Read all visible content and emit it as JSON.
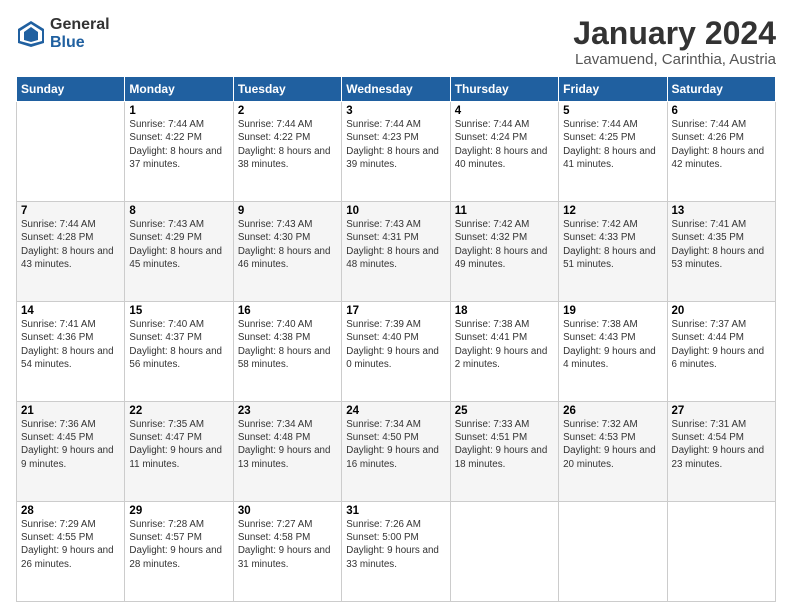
{
  "logo": {
    "general": "General",
    "blue": "Blue"
  },
  "title": "January 2024",
  "subtitle": "Lavamuend, Carinthia, Austria",
  "weekdays": [
    "Sunday",
    "Monday",
    "Tuesday",
    "Wednesday",
    "Thursday",
    "Friday",
    "Saturday"
  ],
  "weeks": [
    [
      {
        "day": "",
        "sunrise": "",
        "sunset": "",
        "daylight": ""
      },
      {
        "day": "1",
        "sunrise": "Sunrise: 7:44 AM",
        "sunset": "Sunset: 4:22 PM",
        "daylight": "Daylight: 8 hours and 37 minutes."
      },
      {
        "day": "2",
        "sunrise": "Sunrise: 7:44 AM",
        "sunset": "Sunset: 4:22 PM",
        "daylight": "Daylight: 8 hours and 38 minutes."
      },
      {
        "day": "3",
        "sunrise": "Sunrise: 7:44 AM",
        "sunset": "Sunset: 4:23 PM",
        "daylight": "Daylight: 8 hours and 39 minutes."
      },
      {
        "day": "4",
        "sunrise": "Sunrise: 7:44 AM",
        "sunset": "Sunset: 4:24 PM",
        "daylight": "Daylight: 8 hours and 40 minutes."
      },
      {
        "day": "5",
        "sunrise": "Sunrise: 7:44 AM",
        "sunset": "Sunset: 4:25 PM",
        "daylight": "Daylight: 8 hours and 41 minutes."
      },
      {
        "day": "6",
        "sunrise": "Sunrise: 7:44 AM",
        "sunset": "Sunset: 4:26 PM",
        "daylight": "Daylight: 8 hours and 42 minutes."
      }
    ],
    [
      {
        "day": "7",
        "sunrise": "Sunrise: 7:44 AM",
        "sunset": "Sunset: 4:28 PM",
        "daylight": "Daylight: 8 hours and 43 minutes."
      },
      {
        "day": "8",
        "sunrise": "Sunrise: 7:43 AM",
        "sunset": "Sunset: 4:29 PM",
        "daylight": "Daylight: 8 hours and 45 minutes."
      },
      {
        "day": "9",
        "sunrise": "Sunrise: 7:43 AM",
        "sunset": "Sunset: 4:30 PM",
        "daylight": "Daylight: 8 hours and 46 minutes."
      },
      {
        "day": "10",
        "sunrise": "Sunrise: 7:43 AM",
        "sunset": "Sunset: 4:31 PM",
        "daylight": "Daylight: 8 hours and 48 minutes."
      },
      {
        "day": "11",
        "sunrise": "Sunrise: 7:42 AM",
        "sunset": "Sunset: 4:32 PM",
        "daylight": "Daylight: 8 hours and 49 minutes."
      },
      {
        "day": "12",
        "sunrise": "Sunrise: 7:42 AM",
        "sunset": "Sunset: 4:33 PM",
        "daylight": "Daylight: 8 hours and 51 minutes."
      },
      {
        "day": "13",
        "sunrise": "Sunrise: 7:41 AM",
        "sunset": "Sunset: 4:35 PM",
        "daylight": "Daylight: 8 hours and 53 minutes."
      }
    ],
    [
      {
        "day": "14",
        "sunrise": "Sunrise: 7:41 AM",
        "sunset": "Sunset: 4:36 PM",
        "daylight": "Daylight: 8 hours and 54 minutes."
      },
      {
        "day": "15",
        "sunrise": "Sunrise: 7:40 AM",
        "sunset": "Sunset: 4:37 PM",
        "daylight": "Daylight: 8 hours and 56 minutes."
      },
      {
        "day": "16",
        "sunrise": "Sunrise: 7:40 AM",
        "sunset": "Sunset: 4:38 PM",
        "daylight": "Daylight: 8 hours and 58 minutes."
      },
      {
        "day": "17",
        "sunrise": "Sunrise: 7:39 AM",
        "sunset": "Sunset: 4:40 PM",
        "daylight": "Daylight: 9 hours and 0 minutes."
      },
      {
        "day": "18",
        "sunrise": "Sunrise: 7:38 AM",
        "sunset": "Sunset: 4:41 PM",
        "daylight": "Daylight: 9 hours and 2 minutes."
      },
      {
        "day": "19",
        "sunrise": "Sunrise: 7:38 AM",
        "sunset": "Sunset: 4:43 PM",
        "daylight": "Daylight: 9 hours and 4 minutes."
      },
      {
        "day": "20",
        "sunrise": "Sunrise: 7:37 AM",
        "sunset": "Sunset: 4:44 PM",
        "daylight": "Daylight: 9 hours and 6 minutes."
      }
    ],
    [
      {
        "day": "21",
        "sunrise": "Sunrise: 7:36 AM",
        "sunset": "Sunset: 4:45 PM",
        "daylight": "Daylight: 9 hours and 9 minutes."
      },
      {
        "day": "22",
        "sunrise": "Sunrise: 7:35 AM",
        "sunset": "Sunset: 4:47 PM",
        "daylight": "Daylight: 9 hours and 11 minutes."
      },
      {
        "day": "23",
        "sunrise": "Sunrise: 7:34 AM",
        "sunset": "Sunset: 4:48 PM",
        "daylight": "Daylight: 9 hours and 13 minutes."
      },
      {
        "day": "24",
        "sunrise": "Sunrise: 7:34 AM",
        "sunset": "Sunset: 4:50 PM",
        "daylight": "Daylight: 9 hours and 16 minutes."
      },
      {
        "day": "25",
        "sunrise": "Sunrise: 7:33 AM",
        "sunset": "Sunset: 4:51 PM",
        "daylight": "Daylight: 9 hours and 18 minutes."
      },
      {
        "day": "26",
        "sunrise": "Sunrise: 7:32 AM",
        "sunset": "Sunset: 4:53 PM",
        "daylight": "Daylight: 9 hours and 20 minutes."
      },
      {
        "day": "27",
        "sunrise": "Sunrise: 7:31 AM",
        "sunset": "Sunset: 4:54 PM",
        "daylight": "Daylight: 9 hours and 23 minutes."
      }
    ],
    [
      {
        "day": "28",
        "sunrise": "Sunrise: 7:29 AM",
        "sunset": "Sunset: 4:55 PM",
        "daylight": "Daylight: 9 hours and 26 minutes."
      },
      {
        "day": "29",
        "sunrise": "Sunrise: 7:28 AM",
        "sunset": "Sunset: 4:57 PM",
        "daylight": "Daylight: 9 hours and 28 minutes."
      },
      {
        "day": "30",
        "sunrise": "Sunrise: 7:27 AM",
        "sunset": "Sunset: 4:58 PM",
        "daylight": "Daylight: 9 hours and 31 minutes."
      },
      {
        "day": "31",
        "sunrise": "Sunrise: 7:26 AM",
        "sunset": "Sunset: 5:00 PM",
        "daylight": "Daylight: 9 hours and 33 minutes."
      },
      {
        "day": "",
        "sunrise": "",
        "sunset": "",
        "daylight": ""
      },
      {
        "day": "",
        "sunrise": "",
        "sunset": "",
        "daylight": ""
      },
      {
        "day": "",
        "sunrise": "",
        "sunset": "",
        "daylight": ""
      }
    ]
  ]
}
